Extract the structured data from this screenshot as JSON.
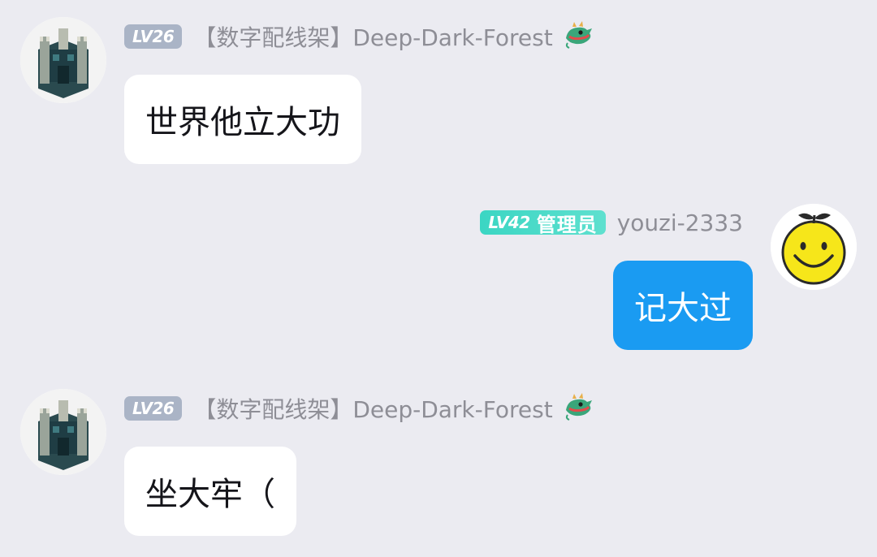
{
  "messages": [
    {
      "direction": "incoming",
      "level": "LV26",
      "role": "",
      "sender": "【数字配线架】Deep-Dark-Forest",
      "text": "世界他立大功",
      "avatar_icon": "minecraft-castle-avatar",
      "name_icon": "dragon-icon"
    },
    {
      "direction": "outgoing",
      "level": "LV42",
      "role": "管理员",
      "sender": "youzi-2333",
      "text": "记大过",
      "avatar_icon": "smiley-fruit-avatar"
    },
    {
      "direction": "incoming",
      "level": "LV26",
      "role": "",
      "sender": "【数字配线架】Deep-Dark-Forest",
      "text": "坐大牢（",
      "avatar_icon": "minecraft-castle-avatar",
      "name_icon": "dragon-icon"
    }
  ],
  "colors": {
    "background": "#ebebf1",
    "incoming_bubble": "#ffffff",
    "outgoing_bubble": "#1a9bf2",
    "admin_badge": "#3bd6c3",
    "level_badge": "#aab4c6",
    "sender_name": "#8e8e96"
  }
}
